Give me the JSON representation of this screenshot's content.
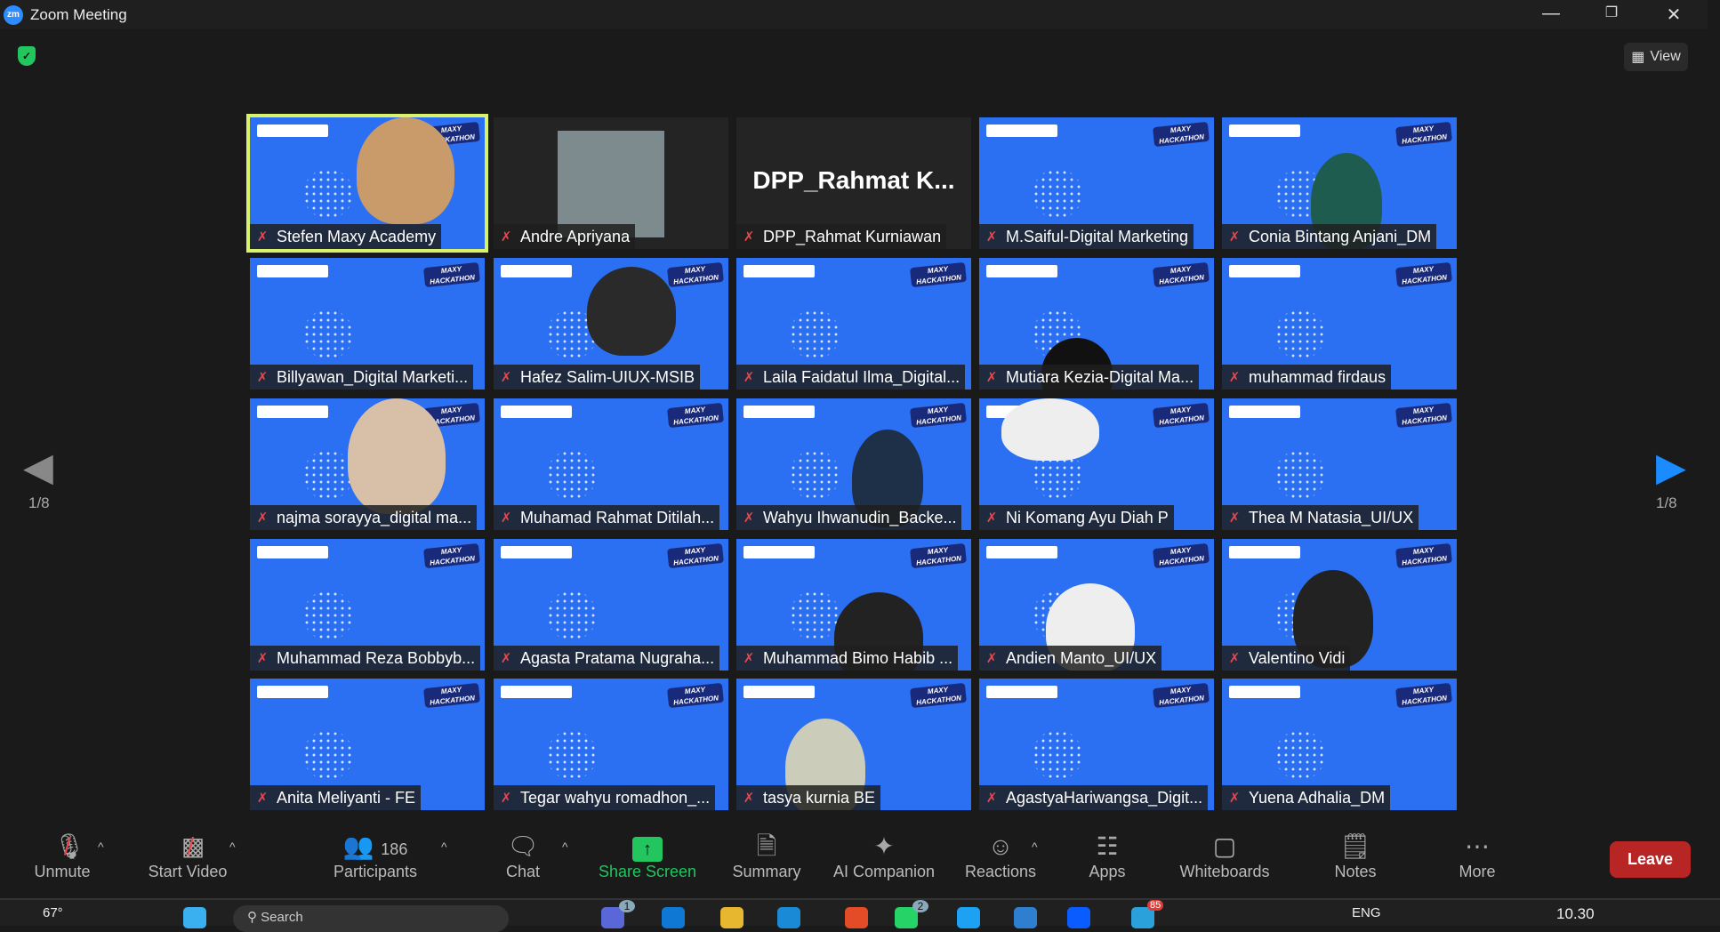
{
  "window": {
    "title": "Zoom Meeting",
    "app_icon": "zm"
  },
  "view_button": "View",
  "pagination": {
    "left": "1/8",
    "right": "1/8"
  },
  "tiles": [
    {
      "name": "Stefen Maxy Academy",
      "type": "video",
      "active": true
    },
    {
      "name": "Andre Apriyana",
      "type": "photo"
    },
    {
      "name": "DPP_Rahmat Kurniawan",
      "type": "text",
      "display": "DPP_Rahmat  K..."
    },
    {
      "name": "M.Saiful-Digital Marketing",
      "type": "video"
    },
    {
      "name": "Conia Bintang Anjani_DM",
      "type": "video"
    },
    {
      "name": "Billyawan_Digital Marketi...",
      "type": "video"
    },
    {
      "name": "Hafez Salim-UIUX-MSIB",
      "type": "video"
    },
    {
      "name": "Laila Faidatul Ilma_Digital...",
      "type": "video"
    },
    {
      "name": "Mutiara Kezia-Digital Ma...",
      "type": "video"
    },
    {
      "name": "muhammad firdaus",
      "type": "video"
    },
    {
      "name": "najma sorayya_digital ma...",
      "type": "video"
    },
    {
      "name": "Muhamad Rahmat Ditilah...",
      "type": "video"
    },
    {
      "name": "Wahyu Ihwanudin_Backe...",
      "type": "video"
    },
    {
      "name": "Ni Komang Ayu Diah P",
      "type": "video"
    },
    {
      "name": "Thea M Natasia_UI/UX",
      "type": "video"
    },
    {
      "name": "Muhammad Reza Bobbyb...",
      "type": "video"
    },
    {
      "name": "Agasta Pratama Nugraha...",
      "type": "video"
    },
    {
      "name": "Muhammad Bimo Habib ...",
      "type": "video"
    },
    {
      "name": "Andien Manto_UI/UX",
      "type": "video"
    },
    {
      "name": "Valentino Vidi",
      "type": "video"
    },
    {
      "name": "Anita Meliyanti - FE",
      "type": "video"
    },
    {
      "name": "Tegar wahyu romadhon_...",
      "type": "video"
    },
    {
      "name": "tasya kurnia BE",
      "type": "video"
    },
    {
      "name": "AgastyaHariwangsa_Digit...",
      "type": "video"
    },
    {
      "name": "Yuena Adhalia_DM",
      "type": "video"
    }
  ],
  "tile_overlay": {
    "hackathon": "MAXY HACKATHON"
  },
  "toolbar": {
    "unmute": "Unmute",
    "start_video": "Start Video",
    "participants": "Participants",
    "participant_count": "186",
    "chat": "Chat",
    "share_screen": "Share Screen",
    "summary": "Summary",
    "ai_companion": "AI Companion",
    "reactions": "Reactions",
    "apps": "Apps",
    "whiteboards": "Whiteboards",
    "notes": "Notes",
    "more": "More",
    "leave": "Leave"
  },
  "taskbar": {
    "weather": "67°",
    "search": "Search",
    "language": "ENG",
    "time": "10.30",
    "teams_badge": "1",
    "whatsapp_badge": "2",
    "telegram_badge": "85"
  },
  "colors": {
    "tile_bg": "#2b6ff2",
    "active_border": "#d9f26b",
    "share_green": "#22c55e",
    "leave_red": "#b72525",
    "nav_blue": "#1a8cff"
  }
}
